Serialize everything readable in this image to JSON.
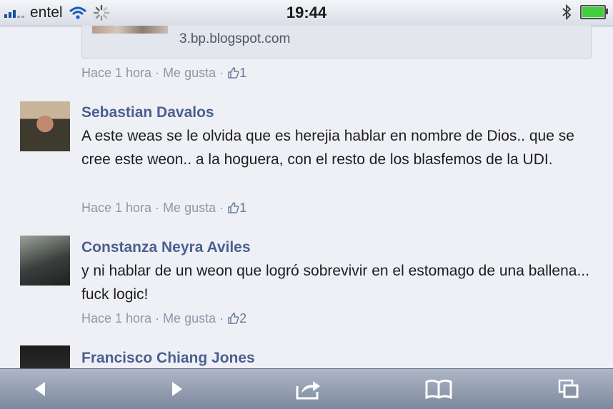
{
  "status_bar": {
    "carrier": "entel",
    "time": "19:44",
    "icons": [
      "signal-icon",
      "wifi-icon",
      "activity-spinner-icon",
      "bluetooth-icon",
      "battery-icon"
    ],
    "battery_color": "#3fcf3a"
  },
  "link_preview": {
    "domain": "3.bp.blogspot.com"
  },
  "meta_top": {
    "time": "Hace 1 hora",
    "like_label": "Me gusta",
    "like_count": "1"
  },
  "comments": [
    {
      "author": "Sebastian Davalos",
      "text": "A este weas se le olvida que es herejia hablar en nombre de Dios.. que se cree este weon.. a la hoguera, con el resto de los blasfemos de la UDI.",
      "time": "Hace 1 hora",
      "like_label": "Me gusta",
      "like_count": "1"
    },
    {
      "author": "Constanza Neyra Aviles",
      "text": "y ni hablar de un weon que logró sobrevivir en el estomago de una ballena... fuck logic!",
      "time": "Hace 1 hora",
      "like_label": "Me gusta",
      "like_count": "2"
    },
    {
      "author": "Francisco Chiang Jones"
    }
  ],
  "toolbar": {
    "buttons": [
      "back-icon",
      "forward-icon",
      "share-icon",
      "bookmarks-icon",
      "tabs-icon"
    ]
  },
  "colors": {
    "author": "#4b5f8f",
    "meta": "#8e97a6",
    "background": "#eef0f6",
    "toolbar": "#8a95a8"
  }
}
